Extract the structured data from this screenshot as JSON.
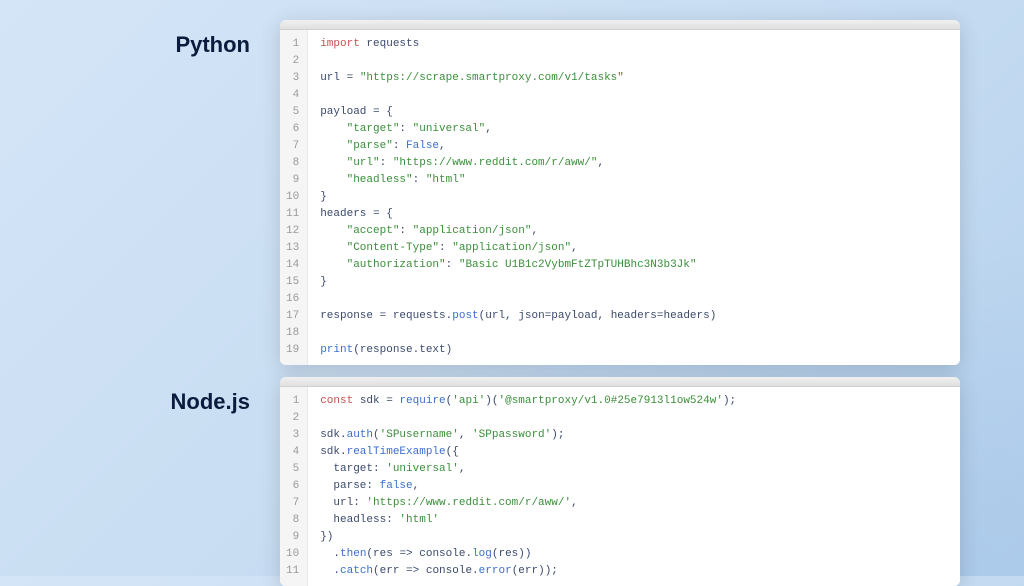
{
  "sections": [
    {
      "label": "Python",
      "language": "python",
      "code": [
        [
          {
            "t": "import",
            "c": "kw"
          },
          {
            "t": " requests",
            "c": "id"
          }
        ],
        [],
        [
          {
            "t": "url ",
            "c": "id"
          },
          {
            "t": "=",
            "c": "op"
          },
          {
            "t": " ",
            "c": "id"
          },
          {
            "t": "\"https://scrape.smartproxy.com/v1/tasks\"",
            "c": "str"
          }
        ],
        [],
        [
          {
            "t": "payload ",
            "c": "id"
          },
          {
            "t": "=",
            "c": "op"
          },
          {
            "t": " {",
            "c": "id"
          }
        ],
        [
          {
            "t": "    ",
            "c": "id"
          },
          {
            "t": "\"target\"",
            "c": "str"
          },
          {
            "t": ": ",
            "c": "id"
          },
          {
            "t": "\"universal\"",
            "c": "str"
          },
          {
            "t": ",",
            "c": "id"
          }
        ],
        [
          {
            "t": "    ",
            "c": "id"
          },
          {
            "t": "\"parse\"",
            "c": "str"
          },
          {
            "t": ": ",
            "c": "id"
          },
          {
            "t": "False",
            "c": "bool"
          },
          {
            "t": ",",
            "c": "id"
          }
        ],
        [
          {
            "t": "    ",
            "c": "id"
          },
          {
            "t": "\"url\"",
            "c": "str"
          },
          {
            "t": ": ",
            "c": "id"
          },
          {
            "t": "\"https://www.reddit.com/r/aww/\"",
            "c": "str"
          },
          {
            "t": ",",
            "c": "id"
          }
        ],
        [
          {
            "t": "    ",
            "c": "id"
          },
          {
            "t": "\"headless\"",
            "c": "str"
          },
          {
            "t": ": ",
            "c": "id"
          },
          {
            "t": "\"html\"",
            "c": "str"
          }
        ],
        [
          {
            "t": "}",
            "c": "id"
          }
        ],
        [
          {
            "t": "headers ",
            "c": "id"
          },
          {
            "t": "=",
            "c": "op"
          },
          {
            "t": " {",
            "c": "id"
          }
        ],
        [
          {
            "t": "    ",
            "c": "id"
          },
          {
            "t": "\"accept\"",
            "c": "str"
          },
          {
            "t": ": ",
            "c": "id"
          },
          {
            "t": "\"application/json\"",
            "c": "str"
          },
          {
            "t": ",",
            "c": "id"
          }
        ],
        [
          {
            "t": "    ",
            "c": "id"
          },
          {
            "t": "\"Content-Type\"",
            "c": "str"
          },
          {
            "t": ": ",
            "c": "id"
          },
          {
            "t": "\"application/json\"",
            "c": "str"
          },
          {
            "t": ",",
            "c": "id"
          }
        ],
        [
          {
            "t": "    ",
            "c": "id"
          },
          {
            "t": "\"authorization\"",
            "c": "str"
          },
          {
            "t": ": ",
            "c": "id"
          },
          {
            "t": "\"Basic U1B1c2VybmFtZTpTUHBhc3N3b3Jk\"",
            "c": "str"
          }
        ],
        [
          {
            "t": "}",
            "c": "id"
          }
        ],
        [],
        [
          {
            "t": "response ",
            "c": "id"
          },
          {
            "t": "=",
            "c": "op"
          },
          {
            "t": " requests.",
            "c": "id"
          },
          {
            "t": "post",
            "c": "fn"
          },
          {
            "t": "(url, json",
            "c": "id"
          },
          {
            "t": "=",
            "c": "op"
          },
          {
            "t": "payload, headers",
            "c": "id"
          },
          {
            "t": "=",
            "c": "op"
          },
          {
            "t": "headers)",
            "c": "id"
          }
        ],
        [],
        [
          {
            "t": "print",
            "c": "fn"
          },
          {
            "t": "(response.text)",
            "c": "id"
          }
        ]
      ]
    },
    {
      "label": "Node.js",
      "language": "javascript",
      "code": [
        [
          {
            "t": "const",
            "c": "kw"
          },
          {
            "t": " sdk ",
            "c": "id"
          },
          {
            "t": "=",
            "c": "op"
          },
          {
            "t": " ",
            "c": "id"
          },
          {
            "t": "require",
            "c": "fn"
          },
          {
            "t": "(",
            "c": "id"
          },
          {
            "t": "'api'",
            "c": "str"
          },
          {
            "t": ")(",
            "c": "id"
          },
          {
            "t": "'@smartproxy/v1.0#25e7913l1ow524w'",
            "c": "str"
          },
          {
            "t": ");",
            "c": "id"
          }
        ],
        [],
        [
          {
            "t": "sdk.",
            "c": "id"
          },
          {
            "t": "auth",
            "c": "fn"
          },
          {
            "t": "(",
            "c": "id"
          },
          {
            "t": "'SPusername'",
            "c": "str"
          },
          {
            "t": ", ",
            "c": "id"
          },
          {
            "t": "'SPpassword'",
            "c": "str"
          },
          {
            "t": ");",
            "c": "id"
          }
        ],
        [
          {
            "t": "sdk.",
            "c": "id"
          },
          {
            "t": "realTimeExample",
            "c": "fn"
          },
          {
            "t": "({",
            "c": "id"
          }
        ],
        [
          {
            "t": "  target: ",
            "c": "id"
          },
          {
            "t": "'universal'",
            "c": "str"
          },
          {
            "t": ",",
            "c": "id"
          }
        ],
        [
          {
            "t": "  parse: ",
            "c": "id"
          },
          {
            "t": "false",
            "c": "bool"
          },
          {
            "t": ",",
            "c": "id"
          }
        ],
        [
          {
            "t": "  url: ",
            "c": "id"
          },
          {
            "t": "'https://www.reddit.com/r/aww/'",
            "c": "str"
          },
          {
            "t": ",",
            "c": "id"
          }
        ],
        [
          {
            "t": "  headless: ",
            "c": "id"
          },
          {
            "t": "'html'",
            "c": "str"
          }
        ],
        [
          {
            "t": "})",
            "c": "id"
          }
        ],
        [
          {
            "t": "  .",
            "c": "id"
          },
          {
            "t": "then",
            "c": "fn"
          },
          {
            "t": "(res ",
            "c": "id"
          },
          {
            "t": "=>",
            "c": "op"
          },
          {
            "t": " console.",
            "c": "id"
          },
          {
            "t": "log",
            "c": "fn"
          },
          {
            "t": "(res))",
            "c": "id"
          }
        ],
        [
          {
            "t": "  .",
            "c": "id"
          },
          {
            "t": "catch",
            "c": "fn"
          },
          {
            "t": "(err ",
            "c": "id"
          },
          {
            "t": "=>",
            "c": "op"
          },
          {
            "t": " console.",
            "c": "id"
          },
          {
            "t": "error",
            "c": "fn"
          },
          {
            "t": "(err));",
            "c": "id"
          }
        ]
      ]
    }
  ]
}
